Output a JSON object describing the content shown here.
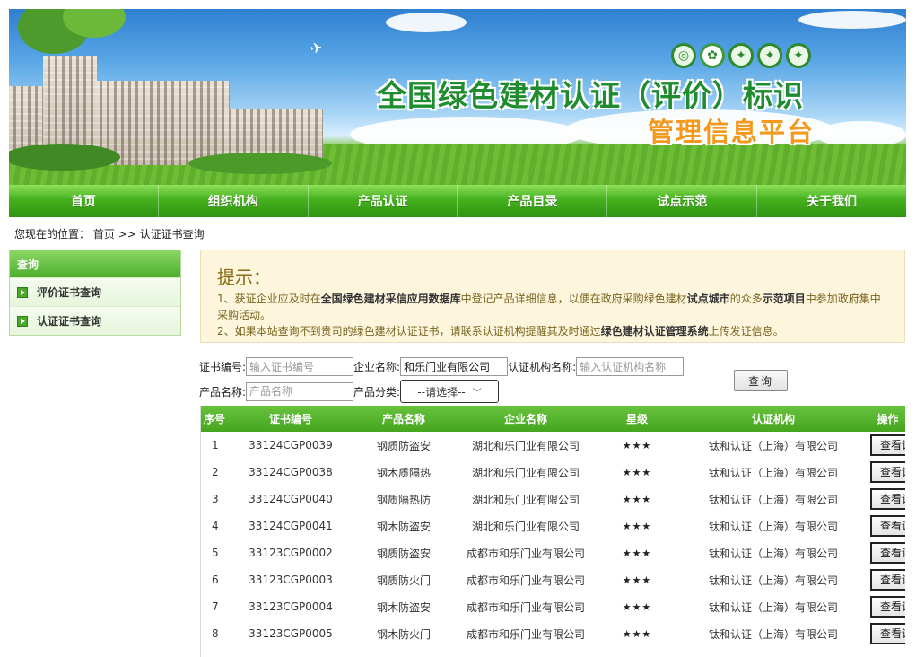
{
  "banner": {
    "title": "全国绿色建材认证（评价）标识",
    "subtitle": "管理信息平台",
    "logo_icons": [
      "cgbmc-logo-icon",
      "star-logo-icon",
      "seal-logo-icon",
      "seal-logo-icon",
      "seal-logo-icon"
    ]
  },
  "nav": {
    "items": [
      "首页",
      "组织机构",
      "产品认证",
      "产品目录",
      "试点示范",
      "关于我们"
    ]
  },
  "breadcrumb": {
    "prefix": "您现在的位置：",
    "home": "首页",
    "separator": ">>",
    "current": "认证证书查询"
  },
  "sidebar": {
    "header": "查询",
    "items": [
      "评价证书查询",
      "认证证书查询"
    ]
  },
  "notice": {
    "title": "提示：",
    "line1_a": "1、获证企业应及时在",
    "line1_b": "全国绿色建材采信应用数据库",
    "line1_c": "中登记产品详细信息，以便在政府采购绿色建材",
    "line1_d": "试点城市",
    "line1_e": "的众多",
    "line1_f": "示范项目",
    "line1_g": "中参加政府集中",
    "line1_h": "采购活动。",
    "line2_a": "2、如果本站查询不到贵司的绿色建材认证证书，请联系认证机构提醒其及时通过",
    "line2_b": "绿色建材认证管理系统",
    "line2_c": "上传发证信息。"
  },
  "form": {
    "cert_no_label": "证书编号:",
    "cert_no_placeholder": "输入证书编号",
    "company_label": "企业名称:",
    "company_value": "和乐门业有限公司",
    "org_label": "认证机构名称:",
    "org_placeholder": "输入认证机构名称",
    "product_label": "产品名称:",
    "product_placeholder": "产品名称",
    "category_label": "产品分类:",
    "category_value": "--请选择--",
    "search_button": "查询"
  },
  "table": {
    "headers": [
      "序号",
      "证书编号",
      "产品名称",
      "企业名称",
      "星级",
      "认证机构",
      "操作"
    ],
    "detail_label": "查看详情",
    "rows": [
      {
        "no": "1",
        "cert": "33124CGP0039",
        "product": "钢质防盗安",
        "company": "湖北和乐门业有限公司",
        "stars": "★★★",
        "org": "钛和认证（上海）有限公司"
      },
      {
        "no": "2",
        "cert": "33124CGP0038",
        "product": "钢木质隔热",
        "company": "湖北和乐门业有限公司",
        "stars": "★★★",
        "org": "钛和认证（上海）有限公司"
      },
      {
        "no": "3",
        "cert": "33124CGP0040",
        "product": "钢质隔热防",
        "company": "湖北和乐门业有限公司",
        "stars": "★★★",
        "org": "钛和认证（上海）有限公司"
      },
      {
        "no": "4",
        "cert": "33124CGP0041",
        "product": "钢木防盗安",
        "company": "湖北和乐门业有限公司",
        "stars": "★★★",
        "org": "钛和认证（上海）有限公司"
      },
      {
        "no": "5",
        "cert": "33123CGP0002",
        "product": "钢质防盗安",
        "company": "成都市和乐门业有限公司",
        "stars": "★★★",
        "org": "钛和认证（上海）有限公司"
      },
      {
        "no": "6",
        "cert": "33123CGP0003",
        "product": "钢质防火门",
        "company": "成都市和乐门业有限公司",
        "stars": "★★★",
        "org": "钛和认证（上海）有限公司"
      },
      {
        "no": "7",
        "cert": "33123CGP0004",
        "product": "钢木防盗安",
        "company": "成都市和乐门业有限公司",
        "stars": "★★★",
        "org": "钛和认证（上海）有限公司"
      },
      {
        "no": "8",
        "cert": "33123CGP0005",
        "product": "钢木防火门",
        "company": "成都市和乐门业有限公司",
        "stars": "★★★",
        "org": "钛和认证（上海）有限公司"
      }
    ]
  },
  "colors": {
    "nav_green": "#45b11e",
    "title_green": "#1f8c2f",
    "subtitle_orange": "#f39a1e",
    "notice_bg": "#fdf6dd"
  }
}
